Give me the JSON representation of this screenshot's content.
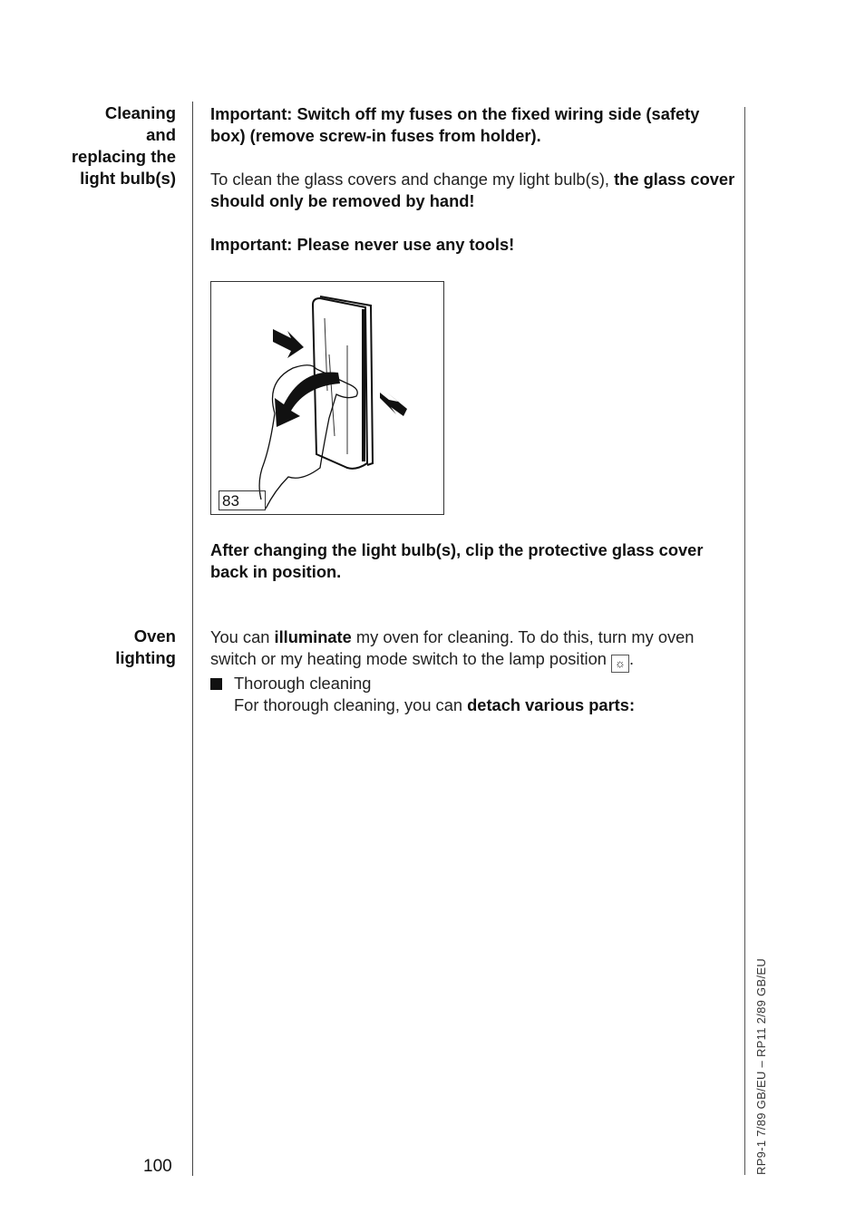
{
  "sections": [
    {
      "heading_lines": [
        "Cleaning",
        "and",
        "replacing the",
        "light bulb(s)"
      ]
    },
    {
      "heading_lines": [
        "Oven",
        "lighting"
      ]
    }
  ],
  "cleaning": {
    "warning_1": "Important: Switch off my fuses on the fixed wiring side (safety box) (remove screw-in fuses from holder).",
    "para_2_normal": "To clean the glass covers and change my light bulb(s), ",
    "para_2_bold": "the glass cover should only be removed by hand!",
    "warning_2": "Important: Please never use any tools!",
    "figure_label": "83",
    "after_note": "After changing the light bulb(s), clip the protective glass cover back in position."
  },
  "oven_lighting": {
    "text_1": "You can ",
    "text_bold": "illuminate",
    "text_2": " my oven for cleaning. To do this, turn my oven switch or my heating mode switch to the lamp position ",
    "lamp_symbol": "☼",
    "text_end": ".",
    "bullet_label": "Thorough cleaning",
    "detach_normal": "For thorough cleaning, you can ",
    "detach_bold": "detach various parts:"
  },
  "footer": {
    "page_number": "100",
    "print_code": "RP9-1 7/89  GB/EU – RP11 2/89  GB/EU"
  }
}
